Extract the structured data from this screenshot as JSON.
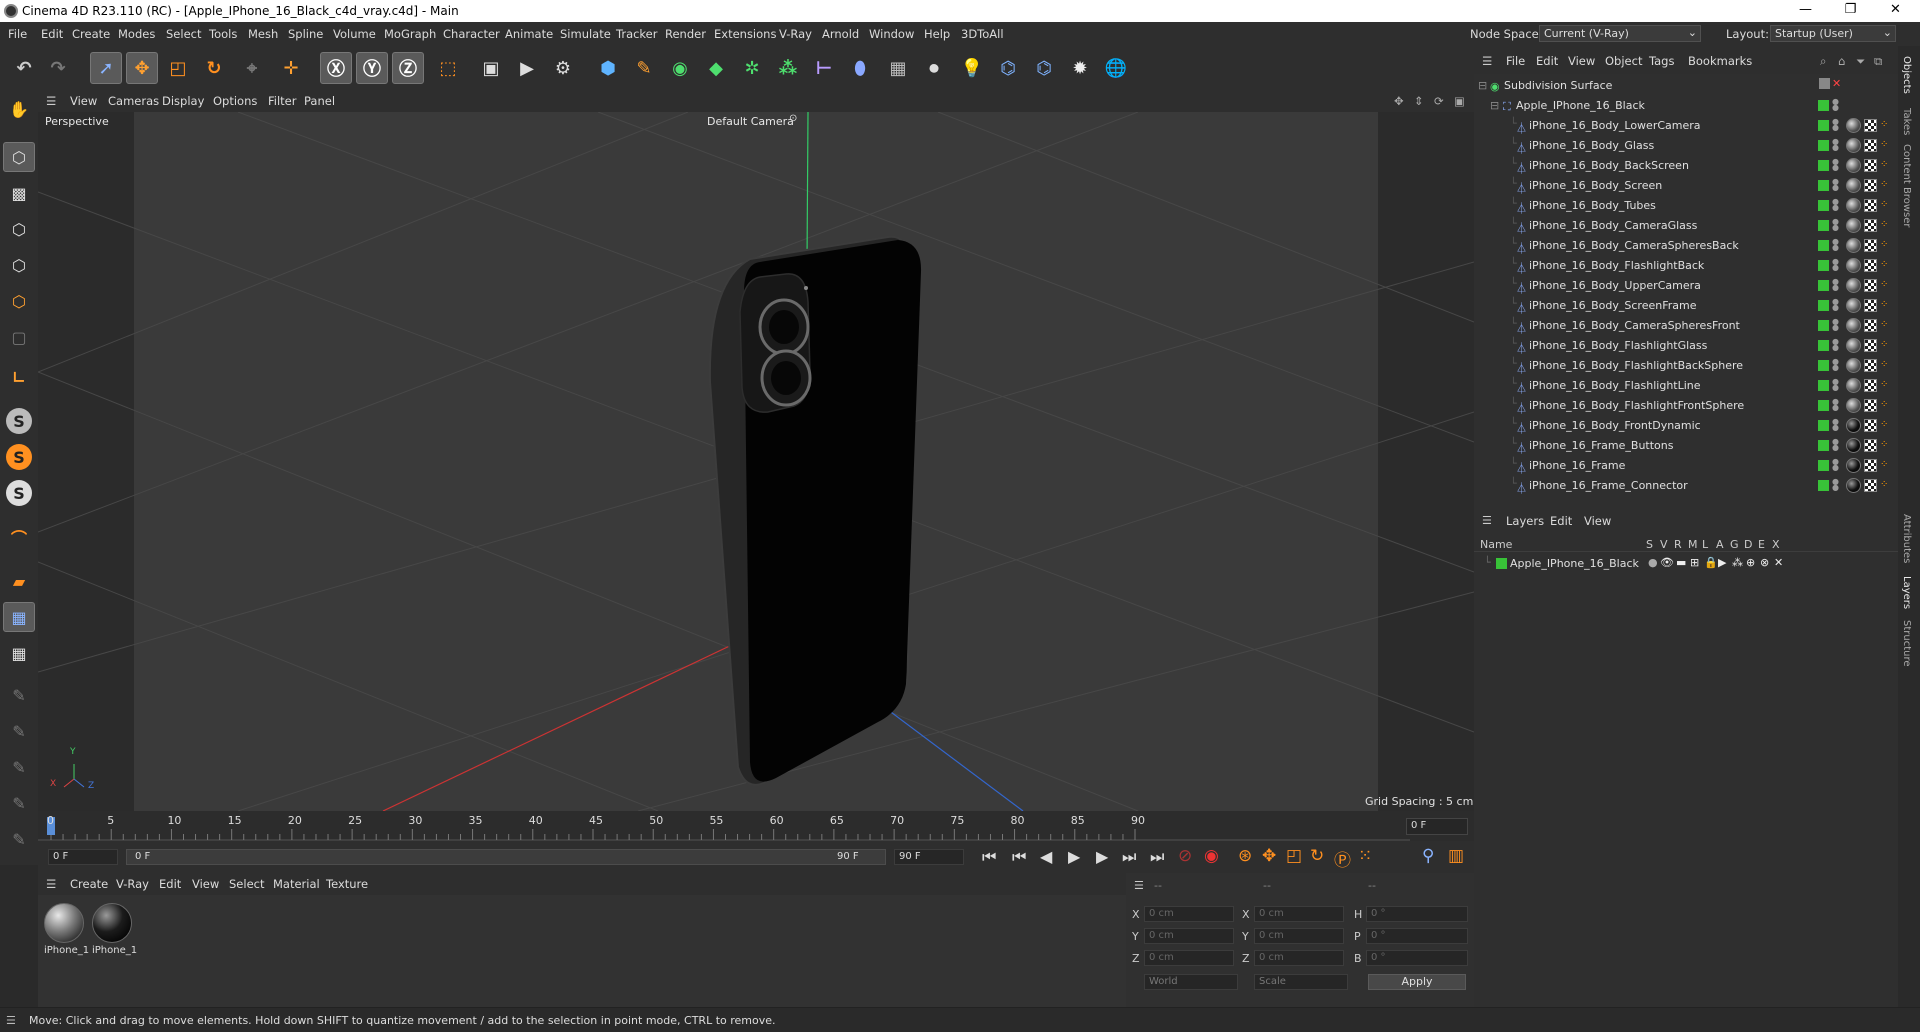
{
  "title": "Cinema 4D R23.110 (RC) - [Apple_IPhone_16_Black_c4d_vray.c4d] - Main",
  "window_controls": {
    "minimize": "—",
    "maximize": "❐",
    "close": "✕"
  },
  "menu": [
    "File",
    "Edit",
    "Create",
    "Modes",
    "Select",
    "Tools",
    "Mesh",
    "Spline",
    "Volume",
    "MoGraph",
    "Character",
    "Animate",
    "Simulate",
    "Tracker",
    "Render",
    "Extensions",
    "V-Ray",
    "Arnold",
    "Window",
    "Help",
    "3DToAll"
  ],
  "node_space": {
    "label": "Node Space:",
    "value": "Current (V-Ray)"
  },
  "layout": {
    "label": "Layout:",
    "value": "Startup (User)"
  },
  "viewport_menu": [
    "View",
    "Cameras",
    "Display",
    "Options",
    "Filter",
    "Panel"
  ],
  "viewport": {
    "name": "Perspective",
    "camera": "Default Camera",
    "grid_spacing": "Grid Spacing : 5 cm",
    "axis_x": "X",
    "axis_y": "Y",
    "axis_z": "Z"
  },
  "timeline": {
    "ticks": [
      "0",
      "5",
      "10",
      "15",
      "20",
      "25",
      "30",
      "35",
      "40",
      "45",
      "50",
      "55",
      "60",
      "65",
      "70",
      "75",
      "80",
      "85",
      "90"
    ],
    "frame_display": "0 F",
    "start": "0 F",
    "range_start": "0 F",
    "range_end": "90 F",
    "end": "90 F"
  },
  "material_menu": [
    "Create",
    "V-Ray",
    "Edit",
    "View",
    "Select",
    "Material",
    "Texture"
  ],
  "materials": [
    "iPhone_1",
    "iPhone_1"
  ],
  "coords": {
    "headers": [
      "--",
      "--",
      "--"
    ],
    "rows": [
      {
        "a": "X",
        "av": "0 cm",
        "b": "X",
        "bv": "0 cm",
        "c": "H",
        "cv": "0 °"
      },
      {
        "a": "Y",
        "av": "0 cm",
        "b": "Y",
        "bv": "0 cm",
        "c": "P",
        "cv": "0 °"
      },
      {
        "a": "Z",
        "av": "0 cm",
        "b": "Z",
        "bv": "0 cm",
        "c": "B",
        "cv": "0 °"
      }
    ],
    "world": "World",
    "scale": "Scale",
    "apply": "Apply"
  },
  "status": "Move: Click and drag to move elements. Hold down SHIFT to quantize movement / add to the selection in point mode, CTRL to remove.",
  "object_menu": [
    "File",
    "Edit",
    "View",
    "Object",
    "Tags",
    "Bookmarks"
  ],
  "objects": {
    "root": "Subdivision Surface",
    "group": "Apple_IPhone_16_Black",
    "items": [
      "iPhone_16_Body_LowerCamera",
      "iPhone_16_Body_Glass",
      "iPhone_16_Body_BackScreen",
      "iPhone_16_Body_Screen",
      "iPhone_16_Body_Tubes",
      "iPhone_16_Body_CameraGlass",
      "iPhone_16_Body_CameraSpheresBack",
      "iPhone_16_Body_FlashlightBack",
      "iPhone_16_Body_UpperCamera",
      "iPhone_16_Body_ScreenFrame",
      "iPhone_16_Body_CameraSpheresFront",
      "iPhone_16_Body_FlashlightGlass",
      "iPhone_16_Body_FlashlightBackSphere",
      "iPhone_16_Body_FlashlightLine",
      "iPhone_16_Body_FlashlightFrontSphere",
      "iPhone_16_Body_FrontDynamic",
      "iPhone_16_Frame_Buttons",
      "iPhone_16_Frame",
      "iPhone_16_Frame_Connector"
    ]
  },
  "layers_menu": [
    "Layers",
    "Edit",
    "View"
  ],
  "layers_header": {
    "name": "Name",
    "cols": [
      "S",
      "V",
      "R",
      "M",
      "L",
      "A",
      "G",
      "D",
      "E",
      "X"
    ]
  },
  "layers": [
    {
      "name": "Apple_IPhone_16_Black"
    }
  ],
  "right_tabs": [
    "Objects",
    "Takes",
    "Content Browser",
    "Attributes",
    "Layers",
    "Structure"
  ]
}
